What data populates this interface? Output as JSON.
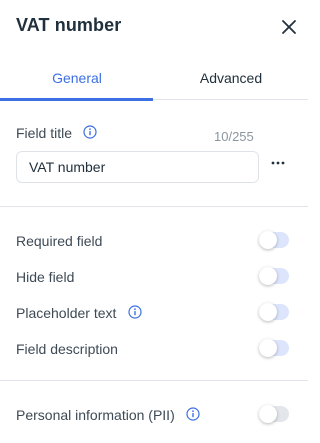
{
  "panel": {
    "title": "VAT number"
  },
  "tabs": [
    {
      "label": "General",
      "active": true
    },
    {
      "label": "Advanced",
      "active": false
    }
  ],
  "field_title": {
    "label": "Field title",
    "counter": "10/255",
    "value": "VAT number"
  },
  "toggles": [
    {
      "label": "Required field",
      "on": false
    },
    {
      "label": "Hide field",
      "on": false
    },
    {
      "label": "Placeholder text",
      "on": false,
      "has_info": true
    },
    {
      "label": "Field description",
      "on": false
    }
  ],
  "pii": {
    "label": "Personal information (PII)",
    "on": false,
    "disabled": true
  },
  "colors": {
    "accent": "#3b6fe3",
    "toggle_track": "#dce5fb",
    "text": "#20303c"
  },
  "icons": {
    "close": "close-icon",
    "info": "info-icon",
    "more": "more-icon"
  }
}
